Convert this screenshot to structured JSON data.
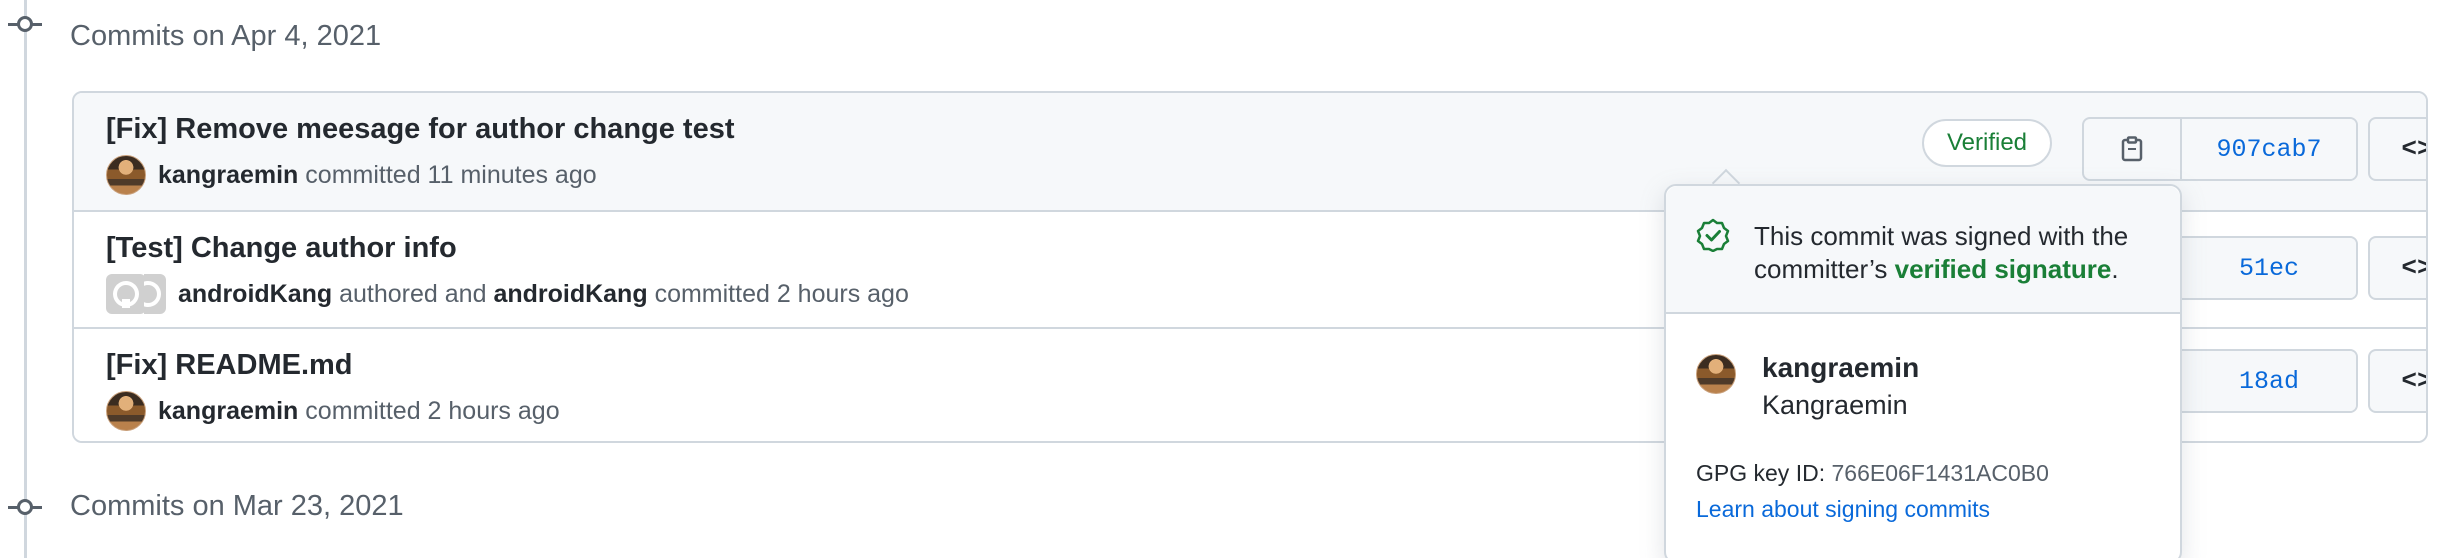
{
  "timeline": {
    "group1_heading": "Commits on Apr 4, 2021",
    "group2_heading": "Commits on Mar 23, 2021"
  },
  "commits": [
    {
      "message": "[Fix] Remove meesage for author change test",
      "committer": "kangraemin",
      "action": "committed 11 minutes ago",
      "verified_label": "Verified",
      "sha": "907cab7"
    },
    {
      "message": "[Test] Change author info",
      "author": "androidKang",
      "authored_text": "authored and",
      "committer": "androidKang",
      "action": "committed 2 hours ago",
      "sha": "51ec"
    },
    {
      "message": "[Fix] README.md",
      "committer": "kangraemin",
      "action": "committed 2 hours ago",
      "sha": "18ad"
    }
  ],
  "popover": {
    "message_prefix": "This commit was signed with the committer’s ",
    "message_link": "verified signature",
    "message_suffix": ".",
    "username": "kangraemin",
    "full_name": "Kangraemin",
    "gpg_label": "GPG key ID: ",
    "gpg_key": "766E06F1431AC0B0",
    "learn_link": "Learn about signing commits"
  },
  "icons": {
    "timeline": "git-commit-icon",
    "copy": "clipboard-icon",
    "browse": "code-icon",
    "verified": "verified-check-icon"
  },
  "colors": {
    "link": "#0969da",
    "verified": "#1a7f37",
    "border": "#d0d7de",
    "muted": "#57606a"
  }
}
